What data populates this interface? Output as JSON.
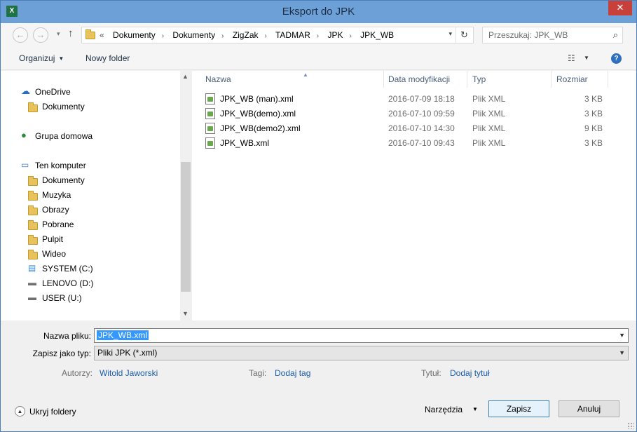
{
  "window": {
    "title": "Eksport do JPK",
    "app_icon": "X",
    "close": "✕"
  },
  "address": {
    "overflow": "«",
    "crumbs": [
      "Dokumenty",
      "Dokumenty",
      "ZigZak",
      "TADMAR",
      "JPK",
      "JPK_WB"
    ],
    "separator": "›"
  },
  "search": {
    "placeholder": "Przeszukaj: JPK_WB"
  },
  "toolbar": {
    "organize_label": "Organizuj",
    "new_folder_label": "Nowy folder"
  },
  "navpane": {
    "items": [
      {
        "label": "OneDrive",
        "icon": "cloud-icon"
      },
      {
        "label": "Dokumenty",
        "icon": "folder-icon"
      },
      {
        "label": "Grupa domowa",
        "icon": "homegroup-icon"
      },
      {
        "label": "Ten komputer",
        "icon": "computer-icon"
      },
      {
        "label": "Dokumenty",
        "icon": "documents-folder-icon"
      },
      {
        "label": "Muzyka",
        "icon": "music-folder-icon"
      },
      {
        "label": "Obrazy",
        "icon": "pictures-folder-icon"
      },
      {
        "label": "Pobrane",
        "icon": "downloads-folder-icon"
      },
      {
        "label": "Pulpit",
        "icon": "desktop-folder-icon"
      },
      {
        "label": "Wideo",
        "icon": "video-folder-icon"
      },
      {
        "label": "SYSTEM (C:)",
        "icon": "system-drive-icon"
      },
      {
        "label": "LENOVO (D:)",
        "icon": "drive-icon"
      },
      {
        "label": "USER (U:)",
        "icon": "drive-icon"
      }
    ]
  },
  "filelist": {
    "columns": [
      "Nazwa",
      "Data modyfikacji",
      "Typ",
      "Rozmiar"
    ],
    "rows": [
      {
        "name": "JPK_WB (man).xml",
        "date": "2016-07-09 18:18",
        "type": "Plik XML",
        "size": "3 KB"
      },
      {
        "name": "JPK_WB(demo).xml",
        "date": "2016-07-10 09:59",
        "type": "Plik XML",
        "size": "3 KB"
      },
      {
        "name": "JPK_WB(demo2).xml",
        "date": "2016-07-10 14:30",
        "type": "Plik XML",
        "size": "9 KB"
      },
      {
        "name": "JPK_WB.xml",
        "date": "2016-07-10 09:43",
        "type": "Plik XML",
        "size": "3 KB"
      }
    ]
  },
  "form": {
    "filename_label": "Nazwa pliku:",
    "filename_value": "JPK_WB.xml",
    "filetype_label": "Zapisz jako typ:",
    "filetype_value": "Pliki JPK (*.xml)",
    "authors_label": "Autorzy:",
    "authors_value": "Witold Jaworski",
    "tags_label": "Tagi:",
    "tags_value": "Dodaj tag",
    "title_label": "Tytuł:",
    "title_value": "Dodaj tytuł"
  },
  "footer": {
    "hide_folders_label": "Ukryj foldery",
    "tools_label": "Narzędzia",
    "save_label": "Zapisz",
    "cancel_label": "Anuluj"
  }
}
